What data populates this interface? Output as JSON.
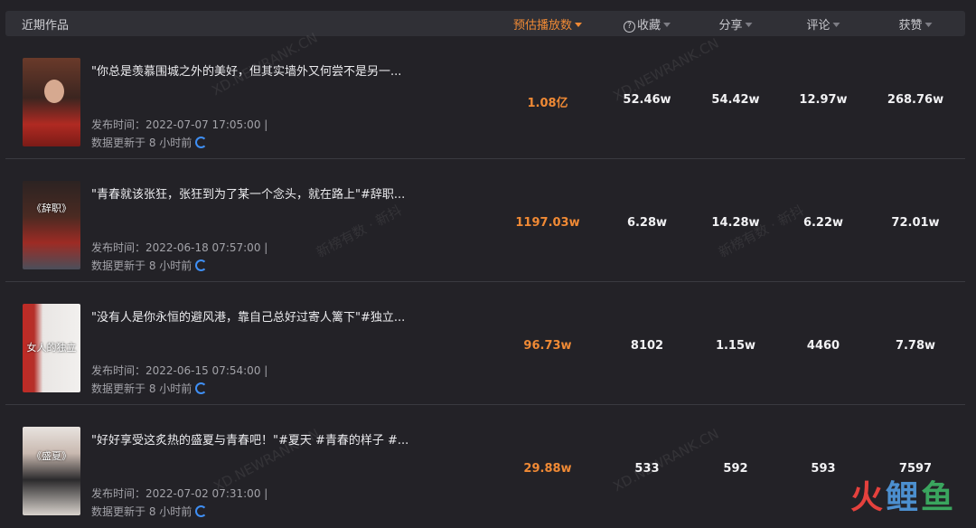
{
  "header": {
    "title": "近期作品",
    "columns": [
      {
        "label": "预估播放数",
        "active": true,
        "help": false
      },
      {
        "label": "收藏",
        "active": false,
        "help": true
      },
      {
        "label": "分享",
        "active": false,
        "help": false
      },
      {
        "label": "评论",
        "active": false,
        "help": false
      },
      {
        "label": "获赞",
        "active": false,
        "help": false
      }
    ]
  },
  "rows": [
    {
      "caption": "\"你总是羡慕围城之外的美好，但其实墙外又何尝不是另一...",
      "publish": "发布时间：2022-07-07 17:05:00  |",
      "updated": "数据更新于 8 小时前",
      "thumb_text": "",
      "plays": "1.08亿",
      "favorites": "52.46w",
      "shares": "54.42w",
      "comments": "12.97w",
      "likes": "268.76w"
    },
    {
      "caption": "\"青春就该张狂，张狂到为了某一个念头，就在路上\"#辞职...",
      "publish": "发布时间：2022-06-18 07:57:00  |",
      "updated": "数据更新于 8 小时前",
      "thumb_text": "《辞职》",
      "plays": "1197.03w",
      "favorites": "6.28w",
      "shares": "14.28w",
      "comments": "6.22w",
      "likes": "72.01w"
    },
    {
      "caption": "\"没有人是你永恒的避风港，靠自己总好过寄人篱下\"#独立...",
      "publish": "发布时间：2022-06-15 07:54:00  |",
      "updated": "数据更新于 8 小时前",
      "thumb_text": "女人的独立",
      "plays": "96.73w",
      "favorites": "8102",
      "shares": "1.15w",
      "comments": "4460",
      "likes": "7.78w"
    },
    {
      "caption": "\"好好享受这炙热的盛夏与青春吧！\"#夏天 #青春的样子 #...",
      "publish": "发布时间：2022-07-02 07:31:00  |",
      "updated": "数据更新于 8 小时前",
      "thumb_text": "《盛夏》",
      "plays": "29.88w",
      "favorites": "533",
      "shares": "592",
      "comments": "593",
      "likes": "7597"
    }
  ],
  "watermarks": [
    "XD.NEWRANK.CN",
    "XD.NEWRANK.CN",
    "新榜有数 · 新抖",
    "新榜有数 · 新抖",
    "XD.NEWRANK.CN",
    "XD.NEWRANK.CN"
  ],
  "brand": {
    "c1": "火",
    "c2": "鲤",
    "c3": "鱼"
  },
  "colors": {
    "accent": "#f08a35",
    "background": "#232227",
    "refresh": "#3f8ff5"
  }
}
